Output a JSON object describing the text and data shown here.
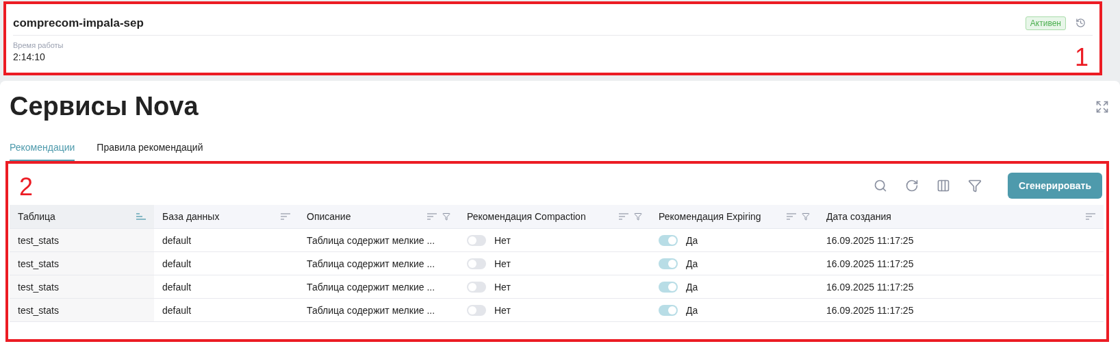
{
  "instance": {
    "annotation": {
      "label": "1"
    },
    "name": "comprecom-impala-sep",
    "status": "Активен",
    "uptime_label": "Время работы",
    "uptime_value": "2:14:10"
  },
  "page": {
    "title": "Сервисы Nova"
  },
  "tabs": [
    {
      "label": "Рекомендации",
      "selected": true
    },
    {
      "label": "Правила рекомендаций",
      "selected": false
    }
  ],
  "table_panel": {
    "annotation": {
      "label": "2"
    },
    "generate_button": "Сгенерировать"
  },
  "table": {
    "columns": [
      {
        "label": "Таблица",
        "sort_active": true,
        "filterable": false
      },
      {
        "label": "База данных",
        "sort_active": false,
        "filterable": false
      },
      {
        "label": "Описание",
        "sort_active": false,
        "filterable": true
      },
      {
        "label": "Рекомендация Compaction",
        "sort_active": false,
        "filterable": true
      },
      {
        "label": "Рекомендация Expiring",
        "sort_active": false,
        "filterable": true
      },
      {
        "label": "Дата создания",
        "sort_active": false,
        "filterable": false
      }
    ],
    "rows": [
      {
        "table": "test_stats",
        "database": "default",
        "description": "Таблица содержит мелкие ...",
        "compaction": {
          "on": false,
          "label": "Нет"
        },
        "expiring": {
          "on": true,
          "label": "Да"
        },
        "created": "16.09.2025 11:17:25"
      },
      {
        "table": "test_stats",
        "database": "default",
        "description": "Таблица содержит мелкие ...",
        "compaction": {
          "on": false,
          "label": "Нет"
        },
        "expiring": {
          "on": true,
          "label": "Да"
        },
        "created": "16.09.2025 11:17:25"
      },
      {
        "table": "test_stats",
        "database": "default",
        "description": "Таблица содержит мелкие ...",
        "compaction": {
          "on": false,
          "label": "Нет"
        },
        "expiring": {
          "on": true,
          "label": "Да"
        },
        "created": "16.09.2025 11:17:25"
      },
      {
        "table": "test_stats",
        "database": "default",
        "description": "Таблица содержит мелкие ...",
        "compaction": {
          "on": false,
          "label": "Нет"
        },
        "expiring": {
          "on": true,
          "label": "Да"
        },
        "created": "16.09.2025 11:17:25"
      }
    ]
  }
}
